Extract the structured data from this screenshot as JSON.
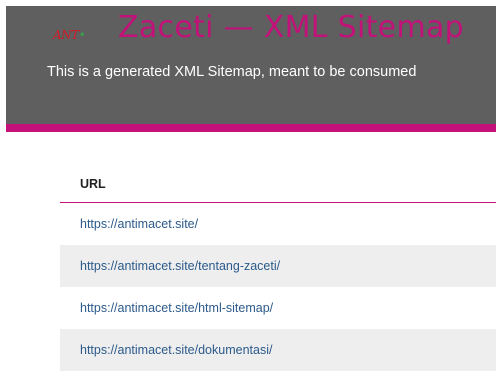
{
  "header": {
    "logo_text": "ANT",
    "logo_dot": "•",
    "title": "Zaceti — XML Sitemap",
    "description": "This is a generated XML Sitemap, meant to be consumed"
  },
  "table": {
    "columns": [
      "URL"
    ],
    "rows": [
      {
        "url": "https://antimacet.site/"
      },
      {
        "url": "https://antimacet.site/tentang-zaceti/"
      },
      {
        "url": "https://antimacet.site/html-sitemap/"
      },
      {
        "url": "https://antimacet.site/dokumentasi/"
      }
    ]
  },
  "colors": {
    "header_bg": "#5f5f5f",
    "accent": "#c5127a",
    "link": "#2c5a8b",
    "row_alt": "#eeeeee"
  }
}
